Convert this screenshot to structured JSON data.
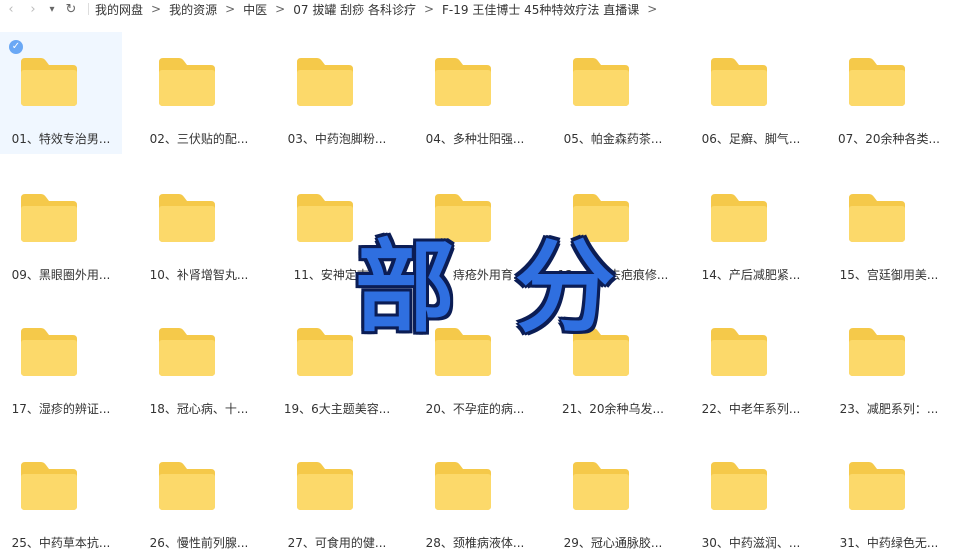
{
  "nav": {
    "back_icon": "chevron-left",
    "forward_icon": "chevron-right",
    "dropdown_icon": "caret-down",
    "refresh_icon": "refresh",
    "back_glyph": "‹",
    "forward_glyph": "›",
    "dropdown_glyph": "▾",
    "refresh_glyph": "↻"
  },
  "breadcrumb": {
    "separator": ">",
    "items": [
      "我的网盘",
      "我的资源",
      "中医",
      "07 拔罐 刮痧 各科诊疗",
      "F-19 王佳博士 45种特效疗法 直播课"
    ]
  },
  "colors": {
    "folder_back": "#f5c94a",
    "folder_front": "#fcd96a",
    "selection_bg": "#f0f7ff",
    "check": "#6aa8f5",
    "watermark_fill": "#2f6fe0",
    "watermark_outline": "#0b1d55"
  },
  "watermark": {
    "char1": "部",
    "char2": "分"
  },
  "folders": [
    {
      "label": "01、特效专治男...",
      "selected": true
    },
    {
      "label": "02、三伏贴的配..."
    },
    {
      "label": "03、中药泡脚粉..."
    },
    {
      "label": "04、多种壮阳强..."
    },
    {
      "label": "05、帕金森药茶..."
    },
    {
      "label": "06、足癣、脚气..."
    },
    {
      "label": "07、20余种各类..."
    },
    {
      "label": "09、黑眼圈外用..."
    },
    {
      "label": "10、补肾增智丸..."
    },
    {
      "label": "11、安神定志..."
    },
    {
      "label": "12、痔疮外用育..."
    },
    {
      "label": "13、祛斑去疤痕修..."
    },
    {
      "label": "14、产后减肥紧..."
    },
    {
      "label": "15、宫廷御用美..."
    },
    {
      "label": "17、湿疹的辨证..."
    },
    {
      "label": "18、冠心病、十..."
    },
    {
      "label": "19、6大主题美容..."
    },
    {
      "label": "20、不孕症的病..."
    },
    {
      "label": "21、20余种乌发..."
    },
    {
      "label": "22、中老年系列..."
    },
    {
      "label": "23、减肥系列：..."
    },
    {
      "label": "25、中药草本抗..."
    },
    {
      "label": "26、慢性前列腺..."
    },
    {
      "label": "27、可食用的健..."
    },
    {
      "label": "28、颈椎病液体..."
    },
    {
      "label": "29、冠心通脉胶..."
    },
    {
      "label": "30、中药滋润、..."
    },
    {
      "label": "31、中药绿色无..."
    }
  ]
}
